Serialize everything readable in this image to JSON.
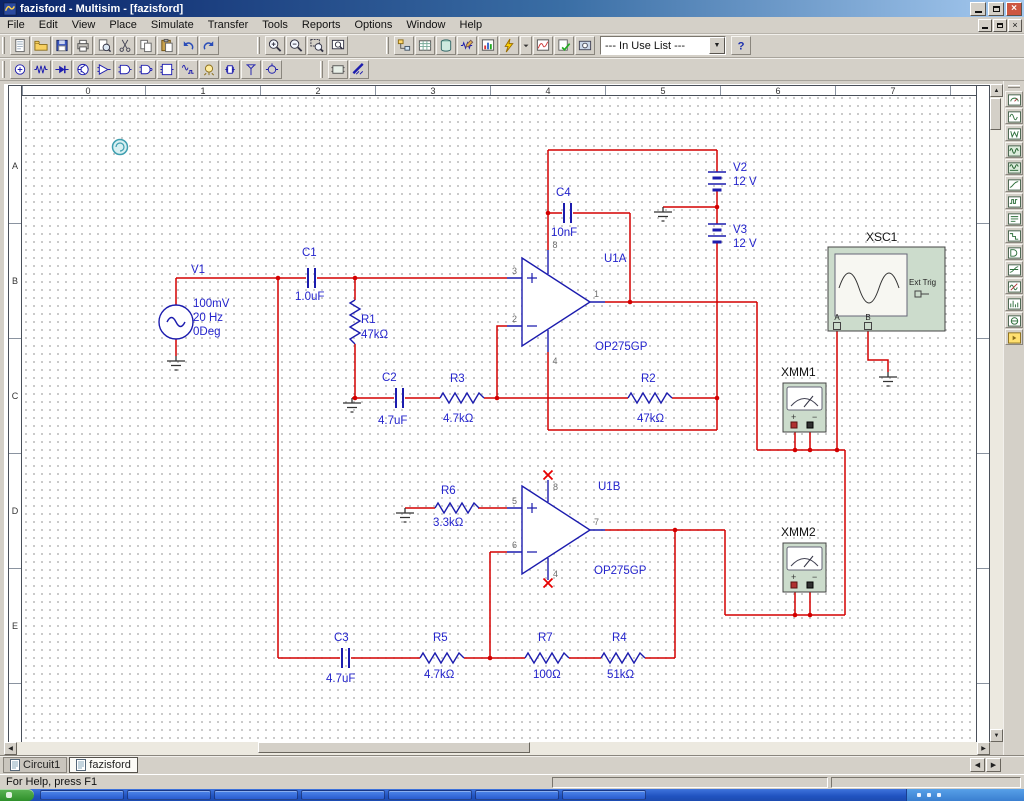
{
  "window": {
    "title": "fazisford - Multisim - [fazisford]"
  },
  "menu": {
    "items": [
      "File",
      "Edit",
      "View",
      "Place",
      "Simulate",
      "Transfer",
      "Tools",
      "Reports",
      "Options",
      "Window",
      "Help"
    ]
  },
  "toolbars": {
    "main": [
      "grip",
      "new",
      "open",
      "save",
      "print",
      "print-preview",
      "cut",
      "copy",
      "paste",
      "undo",
      "redo",
      "gap",
      "grip",
      "zoom-in",
      "zoom-out",
      "zoom-area",
      "zoom-full",
      "gap",
      "grip",
      "design-toolbox",
      "spreadsheet-view",
      "database-manager",
      "create-component",
      "grapher",
      "run-simulation",
      "dropdown",
      "postprocessor",
      "erc",
      "capture-area"
    ],
    "in_use_list": "--- In Use List ---",
    "help": [
      "help"
    ],
    "components": [
      "grip",
      "place-source",
      "place-basic",
      "place-diode",
      "place-transistor",
      "place-analog",
      "place-ttl",
      "place-cmos",
      "place-misc-digital",
      "place-mixed",
      "place-indicator",
      "place-misc",
      "place-rf",
      "place-electromech",
      "gap",
      "grip",
      "place-hier",
      "place-bus"
    ],
    "instruments": [
      "multimeter",
      "function-generator",
      "wattmeter",
      "oscilloscope",
      "four-channel-scope",
      "bode-plotter",
      "frequency-counter",
      "word-generator",
      "logic-analyzer",
      "logic-converter",
      "iv-analyzer",
      "distortion-analyzer",
      "spectrum-analyzer",
      "network-analyzer",
      "labview-instrument"
    ]
  },
  "rulers": {
    "columns": [
      "0",
      "1",
      "2",
      "3",
      "4",
      "5",
      "6",
      "7"
    ],
    "rows": [
      "A",
      "B",
      "C",
      "D",
      "E"
    ]
  },
  "schematic": {
    "v1": {
      "ref": "V1",
      "lines": [
        "100mV",
        "20 Hz",
        "0Deg"
      ]
    },
    "c1": {
      "ref": "C1",
      "value": "1.0uF"
    },
    "r1": {
      "ref": "R1",
      "value": "47kΩ"
    },
    "c2": {
      "ref": "C2",
      "value": "4.7uF"
    },
    "r3": {
      "ref": "R3",
      "value": "4.7kΩ"
    },
    "c4": {
      "ref": "C4",
      "value": "10nF"
    },
    "u1a": {
      "ref": "U1A",
      "part": "OP275GP",
      "pins": {
        "inp": "3",
        "inn": "2",
        "vp": "8",
        "vn": "4",
        "out": "1"
      }
    },
    "r2": {
      "ref": "R2",
      "value": "47kΩ"
    },
    "v2": {
      "ref": "V2",
      "value": "12 V"
    },
    "v3": {
      "ref": "V3",
      "value": "12 V"
    },
    "u1b": {
      "ref": "U1B",
      "part": "OP275GP",
      "pins": {
        "inp": "5",
        "inn": "6",
        "vp": "8",
        "vn": "4",
        "out": "7"
      }
    },
    "r6": {
      "ref": "R6",
      "value": "3.3kΩ"
    },
    "c3": {
      "ref": "C3",
      "value": "4.7uF"
    },
    "r5": {
      "ref": "R5",
      "value": "4.7kΩ"
    },
    "r7": {
      "ref": "R7",
      "value": "100Ω"
    },
    "r4": {
      "ref": "R4",
      "value": "51kΩ"
    },
    "xsc1": {
      "ref": "XSC1",
      "ext_trig": "Ext Trig",
      "ch_a": "A",
      "ch_b": "B"
    },
    "xmm1": {
      "ref": "XMM1"
    },
    "xmm2": {
      "ref": "XMM2"
    }
  },
  "tabs": [
    {
      "label": "Circuit1",
      "active": false
    },
    {
      "label": "fazisford",
      "active": true
    }
  ],
  "status": {
    "message": "For Help, press F1"
  },
  "taskbar": {
    "button_count": 7
  },
  "colors": {
    "wire": "#d40000",
    "component": "#1c1cae",
    "label": "#2424cc",
    "instrument_fill": "#ccdccc"
  }
}
